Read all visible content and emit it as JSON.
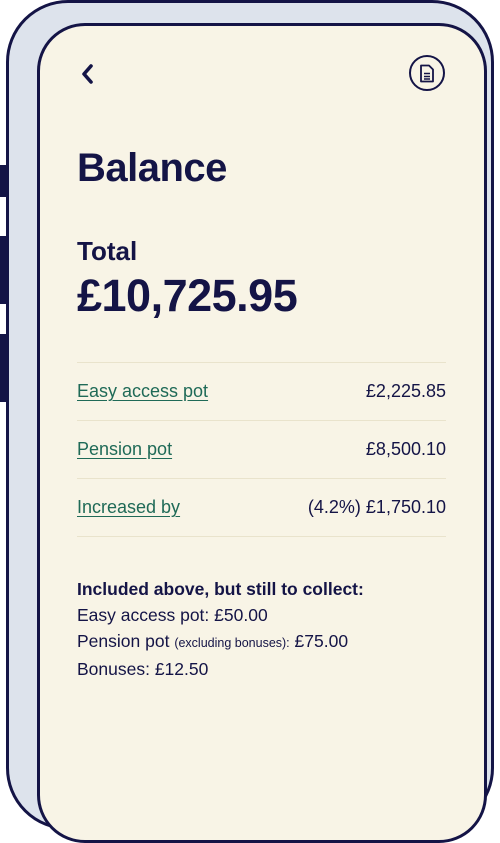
{
  "header": {
    "back_icon": "chevron-left-icon",
    "document_icon": "document-icon"
  },
  "page_title": "Balance",
  "total": {
    "label": "Total",
    "value": "£10,725.95"
  },
  "rows": [
    {
      "label": "Easy access pot",
      "value": "£2,225.85"
    },
    {
      "label": "Pension pot",
      "value": "£8,500.10"
    },
    {
      "label": "Increased by",
      "value": "(4.2%) £1,750.10"
    }
  ],
  "notes": {
    "heading": "Included above, but still to collect:",
    "easy_access": "Easy access pot: £50.00",
    "pension_prefix": "Pension pot",
    "pension_qualifier": "(excluding bonuses):",
    "pension_amount": "£75.00",
    "bonuses": "Bonuses: £12.50"
  },
  "colors": {
    "background": "#f8f4e6",
    "ink": "#141446",
    "link": "#1f6a57",
    "frame": "#dde3ec"
  }
}
